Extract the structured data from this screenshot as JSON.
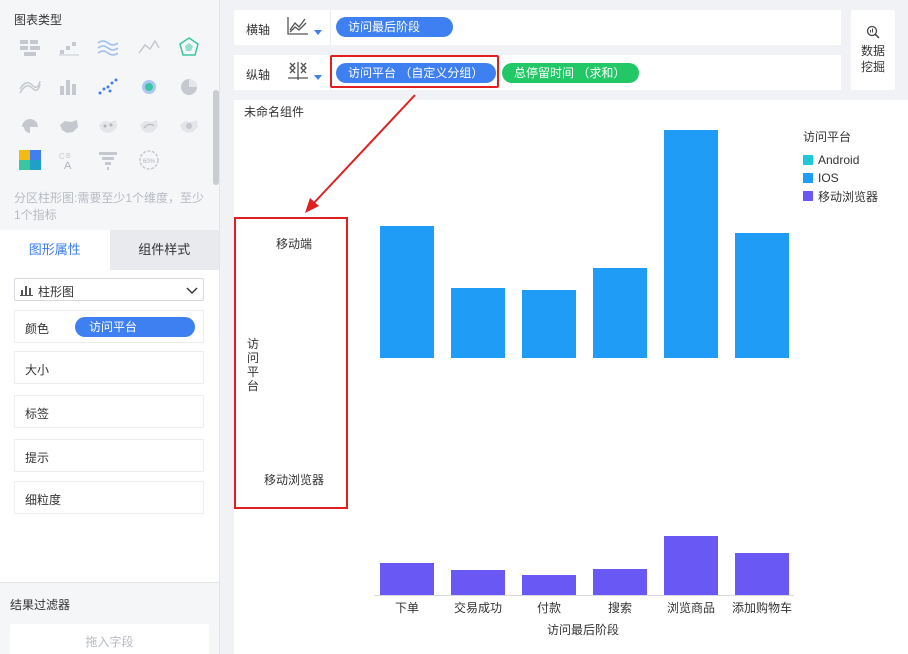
{
  "left_panel": {
    "chart_type_title": "图表类型",
    "hint": "分区柱形图:需要至少1个维度，至少1个指标",
    "tabs": [
      "图形属性",
      "组件样式"
    ],
    "chart_select_value": "柱形图",
    "color_label": "颜色",
    "color_field": "访问平台",
    "properties": [
      "大小",
      "标签",
      "提示",
      "细粒度"
    ],
    "filter_title": "结果过滤器",
    "filter_placeholder": "拖入字段"
  },
  "axes": {
    "x_label": "横轴",
    "x_field": "访问最后阶段",
    "y_label": "纵轴",
    "y_fields": [
      "访问平台 （自定义分组）",
      "总停留时间 （求和）"
    ]
  },
  "data_mining": {
    "line1": "数据",
    "line2": "挖掘"
  },
  "canvas": {
    "component_name": "未命名组件"
  },
  "colors": {
    "accent": "#3e7ff2",
    "green": "#23c866",
    "highlight": "#e02020",
    "android": "#1fc6dc",
    "ios": "#1f9cf5",
    "mobile_browser": "#6a58f5"
  },
  "chart_data": {
    "type": "bar",
    "xlabel": "访问最后阶段",
    "categories": [
      "下单",
      "交易成功",
      "付款",
      "搜索",
      "浏览商品",
      "添加购物车"
    ],
    "facet_axis_label": "访问平台",
    "facets": [
      {
        "name": "移动端",
        "values": [
          132,
          70,
          68,
          90,
          228,
          125
        ]
      },
      {
        "name": "移动浏览器",
        "values": [
          32,
          25,
          20,
          26,
          59,
          42
        ]
      }
    ],
    "legend": {
      "title": "访问平台",
      "items": [
        {
          "name": "Android",
          "color": "#1fc6dc"
        },
        {
          "name": "IOS",
          "color": "#1f9cf5"
        },
        {
          "name": "移动浏览器",
          "color": "#6a58f5"
        }
      ]
    }
  }
}
